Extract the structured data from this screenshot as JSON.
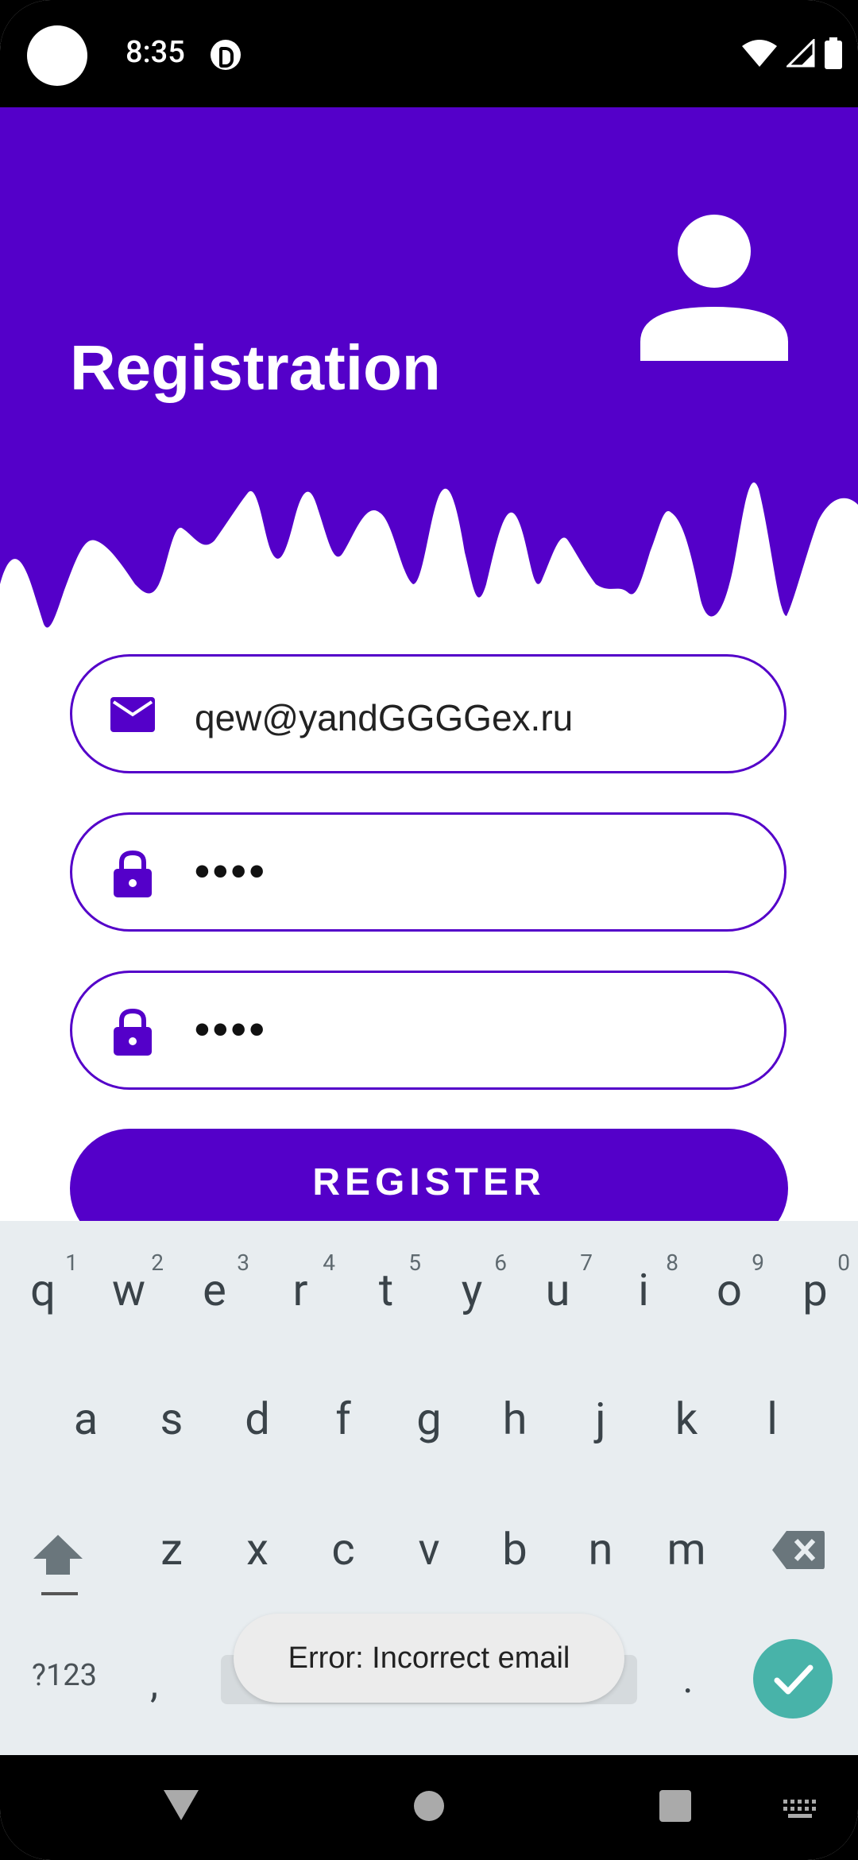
{
  "status_bar": {
    "time": "8:35"
  },
  "header": {
    "title": "Registration",
    "avatar_icon": "person-icon",
    "color": "#5400c9"
  },
  "form": {
    "email": {
      "icon": "mail-icon",
      "value": "qew@yandGGGGex.ru"
    },
    "password": {
      "icon": "lock-icon",
      "value": "••••"
    },
    "confirm_password": {
      "icon": "lock-icon",
      "value": "••••"
    },
    "register_label": "REGISTER"
  },
  "keyboard": {
    "row1": [
      {
        "key": "q",
        "hint": "1"
      },
      {
        "key": "w",
        "hint": "2"
      },
      {
        "key": "e",
        "hint": "3"
      },
      {
        "key": "r",
        "hint": "4"
      },
      {
        "key": "t",
        "hint": "5"
      },
      {
        "key": "y",
        "hint": "6"
      },
      {
        "key": "u",
        "hint": "7"
      },
      {
        "key": "i",
        "hint": "8"
      },
      {
        "key": "o",
        "hint": "9"
      },
      {
        "key": "p",
        "hint": "0"
      }
    ],
    "row2": [
      "a",
      "s",
      "d",
      "f",
      "g",
      "h",
      "j",
      "k",
      "l"
    ],
    "row3": [
      "z",
      "x",
      "c",
      "v",
      "b",
      "n",
      "m"
    ],
    "symbols_label": "?123",
    "comma": ",",
    "period": "."
  },
  "toast": {
    "message": "Error: Incorrect email"
  }
}
